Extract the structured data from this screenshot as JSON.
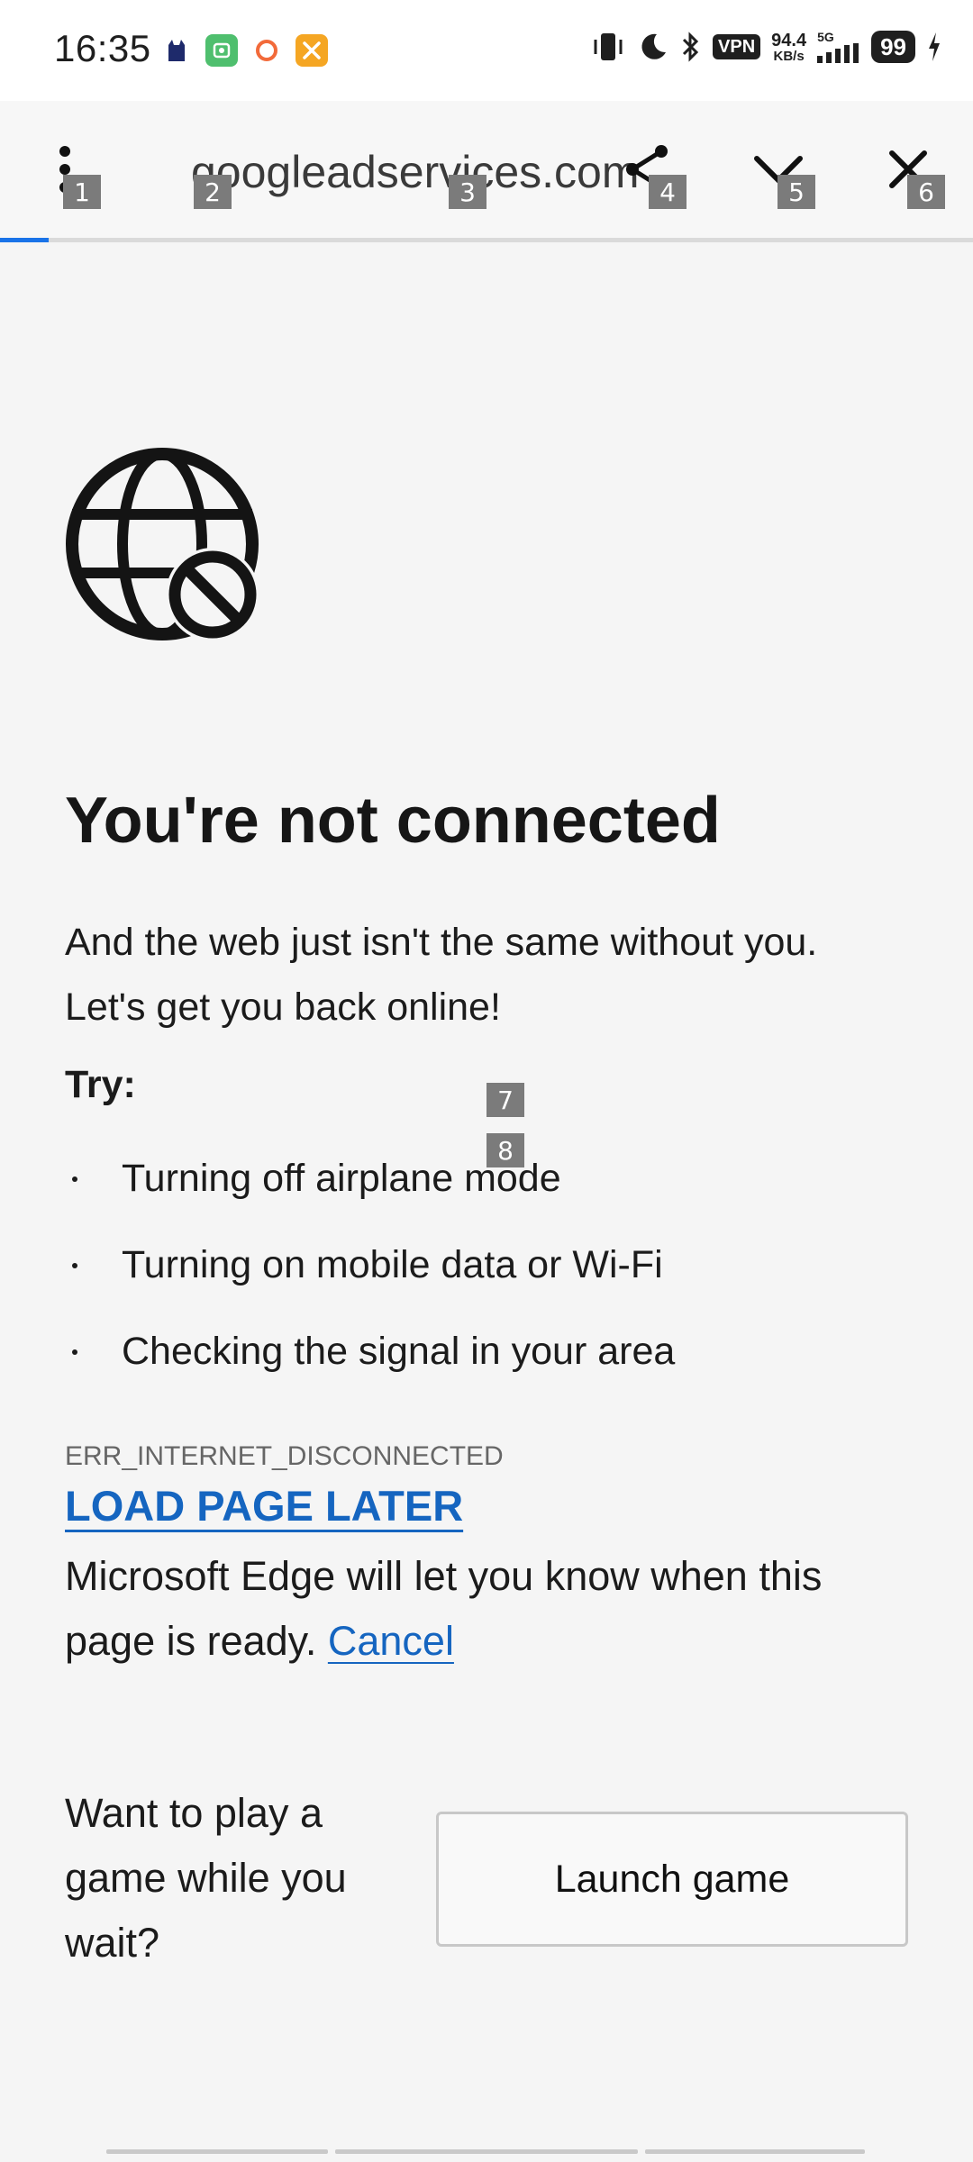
{
  "status_bar": {
    "time": "16:35",
    "notification_icons": [
      "cat-app-icon",
      "wallet-app-icon",
      "record-app-icon",
      "tools-app-icon"
    ],
    "vpn": "VPN",
    "net_speed_value": "94.4",
    "net_speed_unit": "KB/s",
    "net_type": "5G",
    "battery": "99"
  },
  "toolbar": {
    "url": "googleadservices.com",
    "menu_icon": "more-vert-icon",
    "share_icon": "share-icon",
    "collapse_icon": "chevron-down-icon",
    "close_icon": "close-icon",
    "progress_fraction": 0.05,
    "accent_color": "#1a73e8"
  },
  "markers": [
    "1",
    "2",
    "3",
    "4",
    "5",
    "6",
    "7",
    "8"
  ],
  "error_page": {
    "icon": "globe-blocked-icon",
    "title": "You're not connected",
    "intro": "And the web just isn't the same without you. Let's get you back online!",
    "try_label": "Try:",
    "tips": [
      "Turning off airplane mode",
      "Turning on mobile data or Wi-Fi",
      "Checking the signal in your area"
    ],
    "error_code": "ERR_INTERNET_DISCONNECTED",
    "load_later": "LOAD PAGE LATER",
    "notify_text": "Microsoft Edge will let you know when this page is ready.",
    "cancel": "Cancel",
    "link_color": "#1565c0"
  },
  "game": {
    "prompt": "Want to play a game while you wait?",
    "button": "Launch game"
  }
}
